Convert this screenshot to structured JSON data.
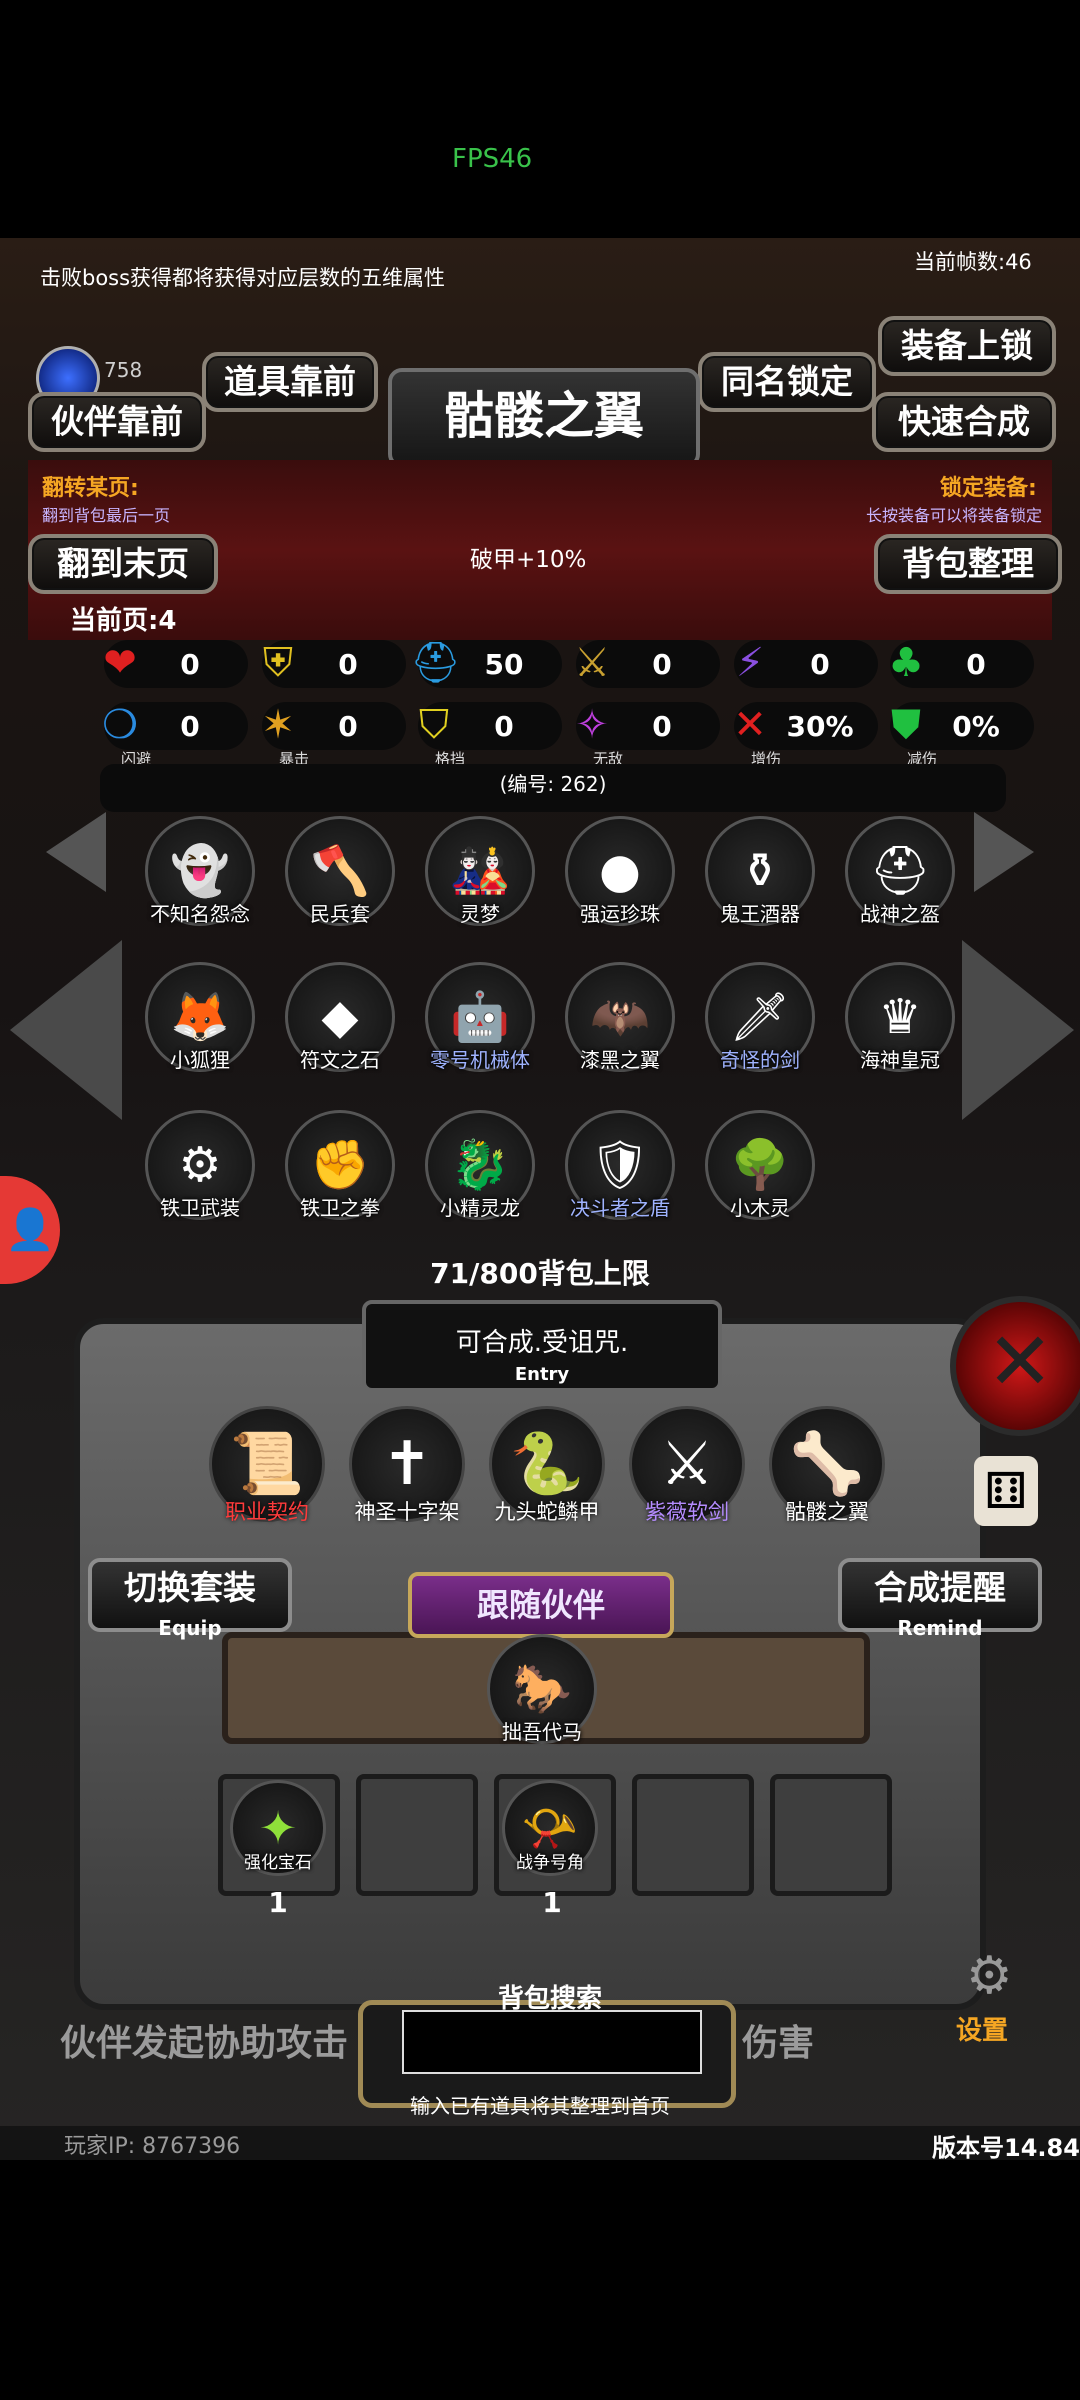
{
  "top": {
    "fps": "FPS46"
  },
  "header": {
    "tip": "击败boss获得都将获得对应层数的五维属性",
    "frame_rate": "当前帧数:46",
    "gem_count": "758",
    "title": "骷髅之翼",
    "btn_item_front": "道具靠前",
    "btn_partner_front": "伙伴靠前",
    "btn_same_lock": "同名锁定",
    "btn_equip_lock": "装备上锁",
    "btn_quick_merge": "快速合成"
  },
  "banner": {
    "flip_title": "翻转某页:",
    "flip_sub": "翻到背包最后一页",
    "lock_title": "锁定装备:",
    "lock_sub": "长按装备可以将装备锁定",
    "btn_last_page": "翻到末页",
    "effect": "破甲+10%",
    "btn_sort": "背包整理",
    "current_page": "当前页:4"
  },
  "stats": [
    {
      "icon": "heart-icon",
      "glyph": "❤",
      "color": "#e02020",
      "value": "0",
      "label": ""
    },
    {
      "icon": "armor-icon",
      "glyph": "⛨",
      "color": "#e0c020",
      "value": "0",
      "label": ""
    },
    {
      "icon": "helmet-icon",
      "glyph": "⛑",
      "color": "#2a9be0",
      "value": "50",
      "label": ""
    },
    {
      "icon": "sword-icon",
      "glyph": "⚔",
      "color": "#c8a030",
      "value": "0",
      "label": ""
    },
    {
      "icon": "lightning-icon",
      "glyph": "⚡",
      "color": "#8a4fe0",
      "value": "0",
      "label": ""
    },
    {
      "icon": "clover-icon",
      "glyph": "♣",
      "color": "#20c040",
      "value": "0",
      "label": ""
    },
    {
      "icon": "dodge-icon",
      "glyph": "❍",
      "color": "#2a8be0",
      "value": "0",
      "label": "闪避"
    },
    {
      "icon": "crit-icon",
      "glyph": "✶",
      "color": "#e0a020",
      "value": "0",
      "label": "暴击"
    },
    {
      "icon": "block-icon",
      "glyph": "⛉",
      "color": "#e0d020",
      "value": "0",
      "label": "格挡"
    },
    {
      "icon": "invincible-icon",
      "glyph": "✧",
      "color": "#c040e0",
      "value": "0",
      "label": "无敌"
    },
    {
      "icon": "damage-up-icon",
      "glyph": "✕",
      "color": "#e02020",
      "value": "30%",
      "label": "增伤"
    },
    {
      "icon": "damage-down-icon",
      "glyph": "⛊",
      "color": "#20c040",
      "value": "0%",
      "label": "减伤"
    }
  ],
  "serial": "(编号: 262)",
  "items": [
    {
      "name": "不知名怨念",
      "glyph": "👻",
      "color": "#ffffff"
    },
    {
      "name": "民兵套",
      "glyph": "🪓",
      "color": "#ffffff"
    },
    {
      "name": "灵梦",
      "glyph": "🎎",
      "color": "#ffffff"
    },
    {
      "name": "强运珍珠",
      "glyph": "●",
      "color": "#ffffff"
    },
    {
      "name": "鬼王酒器",
      "glyph": "⚱",
      "color": "#ffffff"
    },
    {
      "name": "战神之盔",
      "glyph": "⛑",
      "color": "#ffffff"
    },
    {
      "name": "小狐狸",
      "glyph": "🦊",
      "color": "#ffffff"
    },
    {
      "name": "符文之石",
      "glyph": "◆",
      "color": "#ffffff"
    },
    {
      "name": "零号机械体",
      "glyph": "🤖",
      "color": "#9fb3ff"
    },
    {
      "name": "漆黑之翼",
      "glyph": "🦇",
      "color": "#ffffff"
    },
    {
      "name": "奇怪的剑",
      "glyph": "🗡",
      "color": "#9fb3ff"
    },
    {
      "name": "海神皇冠",
      "glyph": "♛",
      "color": "#ffffff"
    },
    {
      "name": "铁卫武装",
      "glyph": "⚙",
      "color": "#ffffff"
    },
    {
      "name": "铁卫之拳",
      "glyph": "✊",
      "color": "#ffffff"
    },
    {
      "name": "小精灵龙",
      "glyph": "🐉",
      "color": "#ffffff"
    },
    {
      "name": "决斗者之盾",
      "glyph": "🛡",
      "color": "#9fb3ff"
    },
    {
      "name": "小木灵",
      "glyph": "🌳",
      "color": "#ffffff"
    }
  ],
  "capacity": "71/800背包上限",
  "entry": {
    "text": "可合成.受诅咒.",
    "sub": "Entry"
  },
  "equipped": [
    {
      "name": "职业契约",
      "glyph": "📜",
      "color": "#ff3b3b"
    },
    {
      "name": "神圣十字架",
      "glyph": "✝",
      "color": "#ffffff"
    },
    {
      "name": "九头蛇鳞甲",
      "glyph": "🐍",
      "color": "#ffffff"
    },
    {
      "name": "紫薇软剑",
      "glyph": "⚔",
      "color": "#b58cff"
    },
    {
      "name": "骷髅之翼",
      "glyph": "🦴",
      "color": "#ffffff"
    }
  ],
  "equip_btn": {
    "label": "切换套装",
    "sub": "Equip"
  },
  "remind_btn": {
    "label": "合成提醒",
    "sub": "Remind"
  },
  "partner": {
    "title": "跟随伙伴",
    "name": "拙吾代马"
  },
  "slots": [
    {
      "name": "强化宝石",
      "count": "1"
    },
    {
      "name": "战争号角",
      "count": "1"
    }
  ],
  "bottom": {
    "bg_text_left": "伙伴发起协助攻击",
    "bg_text_right": "伤害",
    "search_label": "背包搜索",
    "search_hint": "输入已有道具将其整理到首页",
    "settings": "设置",
    "ip": "玩家IP: 8767396",
    "version": "版本号14.84"
  }
}
